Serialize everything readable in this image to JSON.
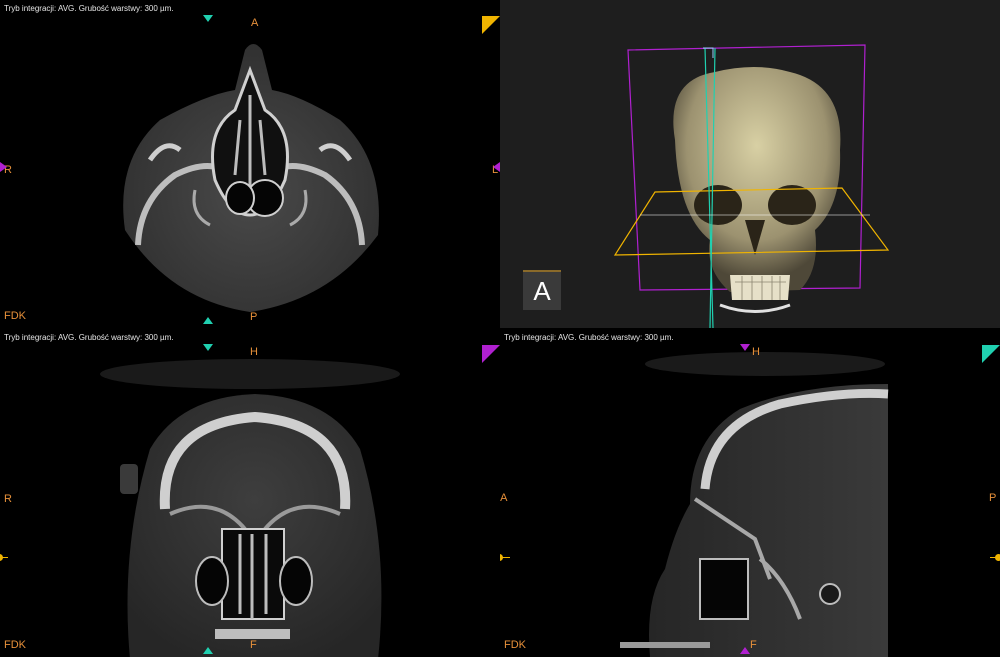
{
  "panes": {
    "axial": {
      "info": "Tryb integracji: AVG. Grubość warstwy: 300 µm.",
      "label_top": "A",
      "label_bottom": "P",
      "label_left": "R",
      "label_right": "L",
      "recon": "FDK"
    },
    "volume3d": {
      "orientation_cube_label": "A"
    },
    "coronal": {
      "info": "Tryb integracji: AVG. Grubość warstwy: 300 µm.",
      "label_top": "H",
      "label_bottom": "F",
      "label_left": "R",
      "recon": "FDK"
    },
    "sagittal": {
      "info": "Tryb integracji: AVG. Grubość warstwy: 300 µm.",
      "label_top": "H",
      "label_bottom": "F",
      "label_left": "L A",
      "label_right": "P",
      "recon": "FDK"
    }
  },
  "colors": {
    "orientation_text": "#e8913a",
    "axial_plane": "#f0b400",
    "coronal_plane": "#b020d0",
    "sagittal_plane": "#20d0b0"
  }
}
